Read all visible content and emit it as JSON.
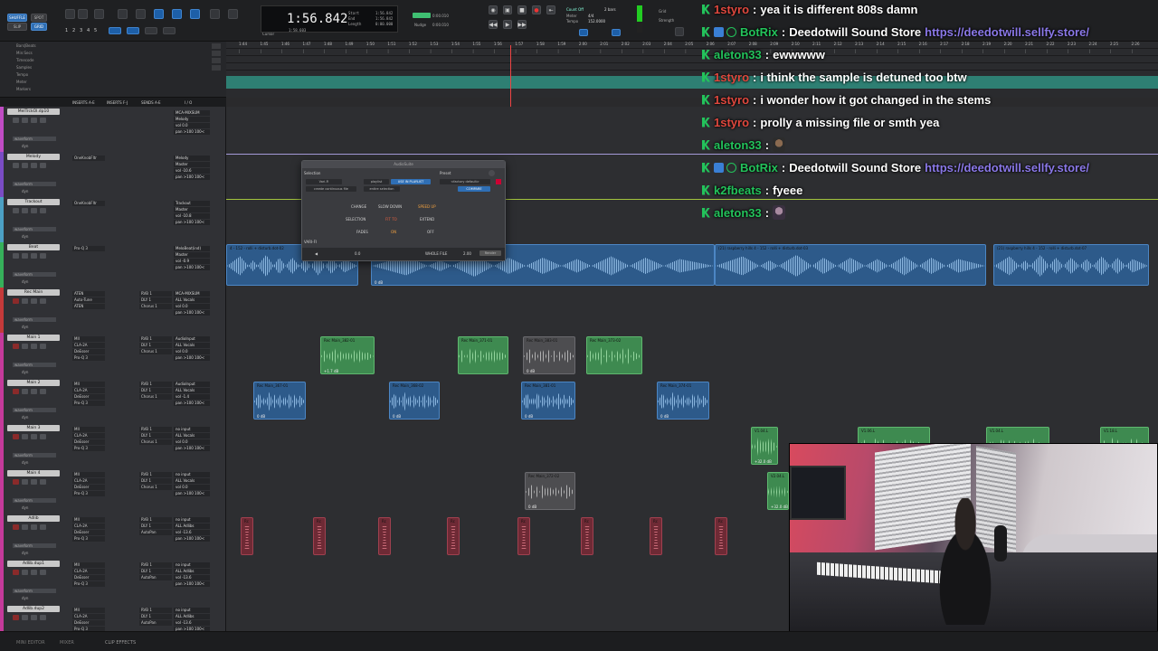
{
  "transport": {
    "main_counter": "1:56.842",
    "labels": {
      "start": "Start",
      "end": "End",
      "length": "Length"
    },
    "start_value": "1:56.842",
    "end_value": "1:56.842",
    "length_value": "0:00.000",
    "cursor_label": "Cursor",
    "cursor_value": "1:58.603",
    "nudge_label": "Nudge",
    "nudge_value": "0:00.010",
    "grid_label": "Grid",
    "grid_value": "0:00.010",
    "count_off": "Count Off",
    "meter_label": "Meter",
    "meter_value": "4/4",
    "tempo_label": "Tempo",
    "tempo_value": "152.0000",
    "bars_value": "2 bars",
    "edit_modes": [
      "SHUFFLE",
      "SPOT",
      "SLIP",
      "GRID"
    ],
    "numbers": [
      "1",
      "2",
      "3",
      "4",
      "5"
    ],
    "strength_label": "Strength"
  },
  "rulers": [
    "Bars|Beats",
    "Min:Secs",
    "Timecode",
    "Samples",
    "Tempo",
    "Meter",
    "Markers"
  ],
  "bar_ticks": [
    "1:44",
    "1:45",
    "1:46",
    "1:47",
    "1:48",
    "1:49",
    "1:50",
    "1:51",
    "1:52",
    "1:53",
    "1:54",
    "1:55",
    "1:56",
    "1:57",
    "1:58",
    "1:59",
    "2:00",
    "2:01",
    "2:02",
    "2:03",
    "2:04",
    "2:05",
    "2:06",
    "2:07",
    "2:08",
    "2:09",
    "2:10",
    "2:11",
    "2:12",
    "2:13",
    "2:14",
    "2:15",
    "2:16",
    "2:17",
    "2:18",
    "2:19",
    "2:20",
    "2:21",
    "2:22",
    "2:23",
    "2:24",
    "2:25",
    "2:26"
  ],
  "marker_text": "Default: 4/4",
  "headers": {
    "inserts_ae": "INSERTS A-E",
    "inserts_fj": "INSERTS F-J",
    "sends_ae": "SENDS A-E",
    "io": "I / O"
  },
  "tracks": [
    {
      "name": "MelTrckOl.dp10",
      "color": "#c04cc4",
      "inserts": [],
      "io": [
        "MCA-MIXSUM",
        "Melody",
        "vol 0.0",
        "pan >100 100<"
      ]
    },
    {
      "name": "Melody",
      "color": "#7a4cc4",
      "inserts": [
        "OneKnobFltr"
      ],
      "io": [
        "Melody",
        "Master",
        "vol -10.6",
        "pan >100 100<"
      ]
    },
    {
      "name": "Trackout",
      "color": "#4ca0c4",
      "inserts": [
        "OneKnobFltr"
      ],
      "io": [
        "Trackout",
        "Master",
        "vol -10.8",
        "pan >100 100<"
      ]
    },
    {
      "name": "Beat",
      "color": "#36b05a",
      "inserts": [
        "Pro-Q 3"
      ],
      "io": [
        "MeloBeat(ind)",
        "Master",
        "vol -0.9",
        "pan >100 100<"
      ]
    },
    {
      "name": "Rec Main",
      "color": "#c43a3a",
      "inserts": [
        "ATEN",
        "Auto-Tune",
        "ATEN"
      ],
      "sends": [
        "RVB 1",
        "DLY 1",
        "Chorus 1"
      ],
      "io": [
        "MCA-MIXSUM",
        "ALL Vocals",
        "vol 0.0",
        "pan >100 100<"
      ]
    },
    {
      "name": "Main 1",
      "color": "#c43a9a",
      "inserts": [
        "MII",
        "CLA-2A",
        "DeEsser",
        "Pro-Q 3"
      ],
      "sends": [
        "RVB 1",
        "DLY 1",
        "Chorus 1"
      ],
      "io": [
        "AudioInput",
        "ALL Vocals",
        "vol 0.0",
        "pan >100 100<"
      ]
    },
    {
      "name": "Main 2",
      "color": "#c43a9a",
      "inserts": [
        "MII",
        "CLA-2A",
        "DeEsser",
        "Pro-Q 3"
      ],
      "sends": [
        "RVB 1",
        "DLY 1",
        "Chorus 1"
      ],
      "io": [
        "AudioInput",
        "ALL Vocals",
        "vol -1.4",
        "pan >100 100<"
      ]
    },
    {
      "name": "Main 3",
      "color": "#c43a9a",
      "inserts": [
        "MII",
        "CLA-2A",
        "DeEsser",
        "Pro-Q 3"
      ],
      "sends": [
        "RVB 1",
        "DLY 1",
        "Chorus 1"
      ],
      "io": [
        "no input",
        "ALL Vocals",
        "vol 0.0",
        "pan >100 100<"
      ]
    },
    {
      "name": "Main 4",
      "color": "#c43a9a",
      "inserts": [
        "MII",
        "CLA-2A",
        "DeEsser",
        "Pro-Q 3"
      ],
      "sends": [
        "RVB 1",
        "DLY 1",
        "Chorus 1"
      ],
      "io": [
        "no input",
        "ALL Vocals",
        "vol 0.0",
        "pan >100 100<"
      ]
    },
    {
      "name": "Adlib",
      "color": "#c43a9a",
      "inserts": [
        "MII",
        "CLA-2A",
        "DeEsser",
        "Pro-Q 3"
      ],
      "sends": [
        "RVB 1",
        "DLY 1",
        "AutoPan"
      ],
      "io": [
        "no input",
        "ALL Adlibs",
        "vol -13.6",
        "pan >100 100<"
      ]
    },
    {
      "name": "Adlib.dup1",
      "color": "#c43a9a",
      "inserts": [
        "MII",
        "CLA-2A",
        "DeEsser",
        "Pro-Q 3"
      ],
      "sends": [
        "RVB 1",
        "DLY 1",
        "AutoPan"
      ],
      "io": [
        "no input",
        "ALL Adlibs",
        "vol -13.6",
        "pan >100 100<"
      ]
    },
    {
      "name": "Adlib.dup2",
      "color": "#c43a9a",
      "inserts": [
        "MII",
        "CLA-2A",
        "DeEsser",
        "Pro-Q 3"
      ],
      "sends": [
        "RVB 1",
        "DLY 1",
        "AutoPan"
      ],
      "io": [
        "no input",
        "ALL Adlibs",
        "vol -13.6",
        "pan >100 100<"
      ]
    }
  ],
  "track_labels": {
    "waveform": "waveform",
    "dyn": "dyn"
  },
  "clips": {
    "beat_1": "4 - 152 - rolli + disturb.dot-02",
    "beat_2": "(21) raspberry hills 4 - 152 - rolli + disturb.dot-03",
    "beat_3": "(21)",
    "beat_4": "(21) raspberry hills 4 - 152 - rolli + disturb.dot-07",
    "beat_db": "0 dB",
    "m1_a": "Rec Main_382-01",
    "m1_b": "Rec Main_371-01",
    "m1_c": "Rec Main_383-01",
    "m1_d": "Rec Main_373-02",
    "m2_a": "Rec Main_367-01",
    "m2_b": "Rec Main_368-02",
    "m2_c": "Rec Main_381-01",
    "m2_d": "Rec Main_374-01",
    "m4_a": "Rec Main_372-02",
    "m3_a": "V1.04.L",
    "m3_b": "V1.06.L",
    "m3_c": "V1.04.L",
    "m3_d": "V1.18.L",
    "m4_b": "V2.04.L",
    "db_plus": "+1.7 dB",
    "db_zero": "0 dB",
    "db_32": "+32.0 dB",
    "adlib_r": "Rc"
  },
  "plugin": {
    "title": "AudioSuite",
    "selection_label": "Selection",
    "preset_label": "Preset",
    "plugin_name": "Vari-Fi",
    "playlist": "playlist",
    "use_in_playlist": "USE IN PLAYLIST",
    "factory_default": "<factory default>",
    "create_continuous": "create continuous file",
    "entire_selection": "entire selection",
    "compare": "COMPARE",
    "change_label": "CHANGE",
    "slow_down": "SLOW DOWN",
    "speed_up": "SPEED UP",
    "selection_row_label": "SELECTION",
    "fit_to": "FIT TO",
    "extend": "EXTEND",
    "fades_label": "FADES",
    "fades_on": "ON",
    "fades_off": "OFF",
    "footer_name": "VARI-FI",
    "handle_label": "WHOLE FILE",
    "handle_value": "2.00",
    "render": "Render",
    "value": "0.0"
  },
  "chat": [
    {
      "user": "1styro",
      "user_color": "#e0483e",
      "text": "yea it is different 808s damn",
      "badge": "kick"
    },
    {
      "user": "BotRix",
      "user_color": "#23c35b",
      "text": "Deedotwill Sound Store",
      "link": "https://deedotwill.sellfy.store/",
      "badge": "bot"
    },
    {
      "user": "aleton33",
      "user_color": "#23c35b",
      "text": "ewwwww",
      "badge": "kick"
    },
    {
      "user": "1styro",
      "user_color": "#e0483e",
      "text": "i think the sample is detuned too btw",
      "badge": "kick"
    },
    {
      "user": "1styro",
      "user_color": "#e0483e",
      "text": "i wonder how it got changed in the stems",
      "badge": "kick"
    },
    {
      "user": "1styro",
      "user_color": "#e0483e",
      "text": "prolly a missing file or smth yea",
      "badge": "kick"
    },
    {
      "user": "aleton33",
      "user_color": "#23c35b",
      "text": "",
      "emote": "emote-face",
      "badge": "kick"
    },
    {
      "user": "BotRix",
      "user_color": "#23c35b",
      "text": "Deedotwill Sound Store",
      "link": "https://deedotwill.sellfy.store/",
      "badge": "bot"
    },
    {
      "user": "k2fbeats",
      "user_color": "#23c35b",
      "text": "fyeee",
      "badge": "kick"
    },
    {
      "user": "aleton33",
      "user_color": "#23c35b",
      "text": "",
      "emote": "emote-face-2",
      "badge": "kick"
    }
  ],
  "bottombar": {
    "left": "MINI EDITOR",
    "mid": "MIXER",
    "clip_effects": "CLIP EFFECTS"
  },
  "colors": {
    "accent_blue": "#2f6fb5",
    "record_red": "#e33333",
    "marker_teal": "#2e7f73",
    "kick_green": "#23c35b"
  }
}
